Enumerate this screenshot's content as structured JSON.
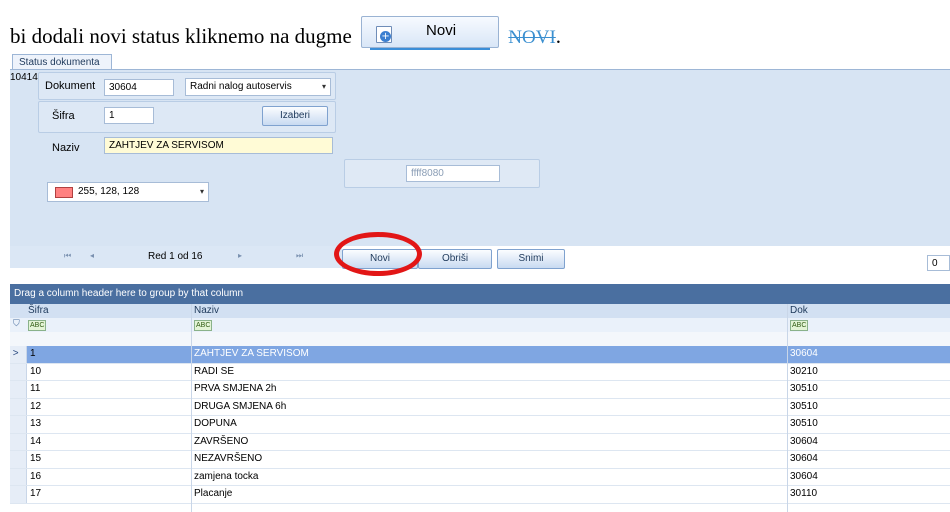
{
  "doc": {
    "line_text": "bi dodali novi status kliknemo na dugme",
    "inline_button_label": "Novi",
    "link_text": "NOVI",
    "end_punct": "."
  },
  "tab": {
    "label": "Status dokumenta"
  },
  "form": {
    "record_id": "10414",
    "dokument_label": "Dokument",
    "dokument_value": "30604",
    "dokument_combo": "Radni nalog autoservis",
    "sifra_label": "Šifra",
    "sifra_value": "1",
    "izaberi_label": "Izaberi",
    "naziv_label": "Naziv",
    "naziv_value": "ZAHTJEV ZA SERVISOM",
    "hex_value": "ffff8080",
    "color_value": "255, 128, 128",
    "color_hex": "#ff8080"
  },
  "navigator": {
    "record_text": "Red 1 od 16",
    "buttons": {
      "novi": "Novi",
      "obrisi": "Obriši",
      "snimi": "Snimi"
    },
    "right_value": "0"
  },
  "grid": {
    "group_hint": "Drag a column header here to group by that column",
    "columns": [
      "Šifra",
      "Naziv",
      "Dok"
    ],
    "filter_glyph": "ABC",
    "rows": [
      [
        "1",
        "ZAHTJEV ZA SERVISOM",
        "30604"
      ],
      [
        "10",
        "RADI SE",
        "30210"
      ],
      [
        "11",
        "PRVA SMJENA 2h",
        "30510"
      ],
      [
        "12",
        "DRUGA SMJENA 6h",
        "30510"
      ],
      [
        "13",
        "DOPUNA",
        "30510"
      ],
      [
        "14",
        "ZAVRŠENO",
        "30604"
      ],
      [
        "15",
        "NEZAVRŠENO",
        "30604"
      ],
      [
        "16",
        "zamjena tocka",
        "30604"
      ],
      [
        "17",
        "Placanje",
        "30110"
      ]
    ]
  },
  "colors": {
    "highlight": "#e21616",
    "selected_row": "#7fa6e2"
  }
}
